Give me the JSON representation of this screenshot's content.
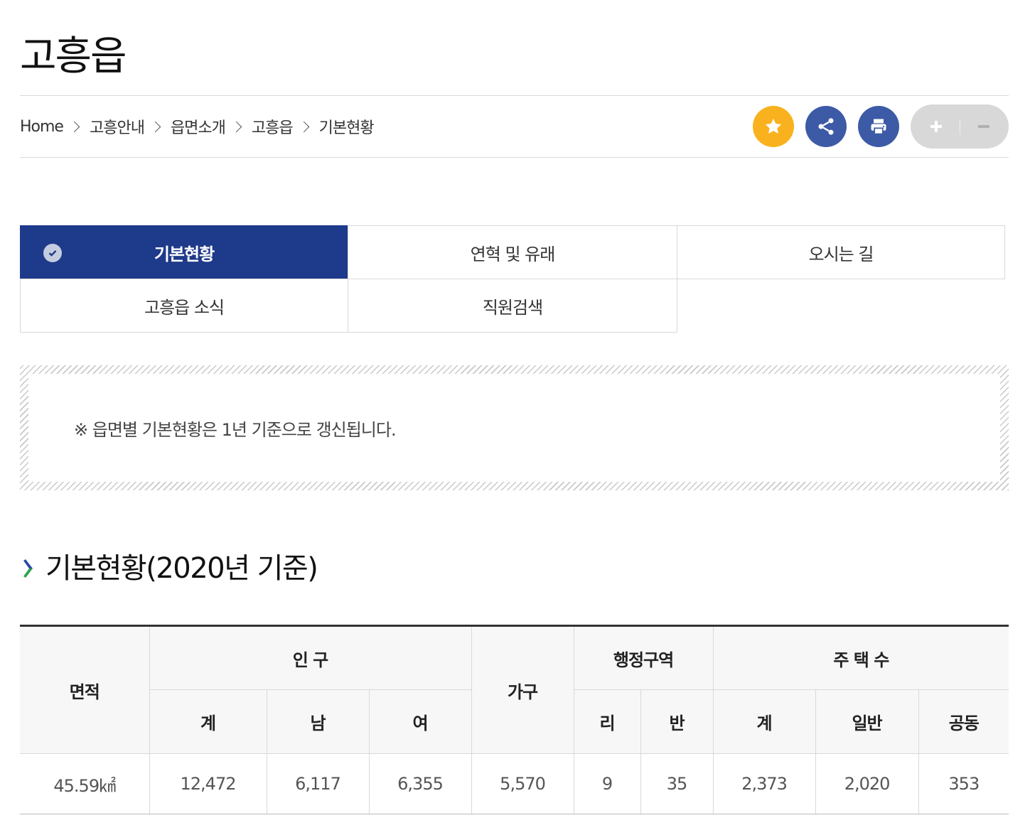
{
  "page": {
    "title": "고흥읍"
  },
  "breadcrumb": [
    "Home",
    "고흥안내",
    "읍면소개",
    "고흥읍",
    "기본현황"
  ],
  "tools": {
    "favorite_icon": "star-icon",
    "share_icon": "share-icon",
    "print_icon": "print-icon",
    "zoom_in_icon": "plus-icon",
    "zoom_out_icon": "minus-icon",
    "colors": {
      "favorite": "#f9b21d",
      "share": "#3c5aa6",
      "print": "#3c5aa6",
      "zoom": "#d8d8d8"
    }
  },
  "tabs": [
    {
      "label": "기본현황",
      "active": true
    },
    {
      "label": "연혁 및 유래",
      "active": false
    },
    {
      "label": "오시는 길",
      "active": false
    },
    {
      "label": "고흥읍 소식",
      "active": false
    },
    {
      "label": "직원검색",
      "active": false
    }
  ],
  "tab_active_color": "#1e3a8a",
  "notice": {
    "text": "※ 읍면별 기본현황은 1년 기준으로 갱신됩니다."
  },
  "section": {
    "title": "기본현황(2020년 기준)"
  },
  "table": {
    "headers": {
      "area": "면적",
      "population": "인 구",
      "households": "가구",
      "admin": "행정구역",
      "housing": "주 택 수",
      "pop_total": "계",
      "pop_male": "남",
      "pop_female": "여",
      "admin_ri": "리",
      "admin_ban": "반",
      "housing_total": "계",
      "housing_general": "일반",
      "housing_shared": "공동"
    },
    "row": {
      "area": "45.59㎢",
      "pop_total": "12,472",
      "pop_male": "6,117",
      "pop_female": "6,355",
      "households": "5,570",
      "admin_ri": "9",
      "admin_ban": "35",
      "housing_total": "2,373",
      "housing_general": "2,020",
      "housing_shared": "353"
    }
  }
}
